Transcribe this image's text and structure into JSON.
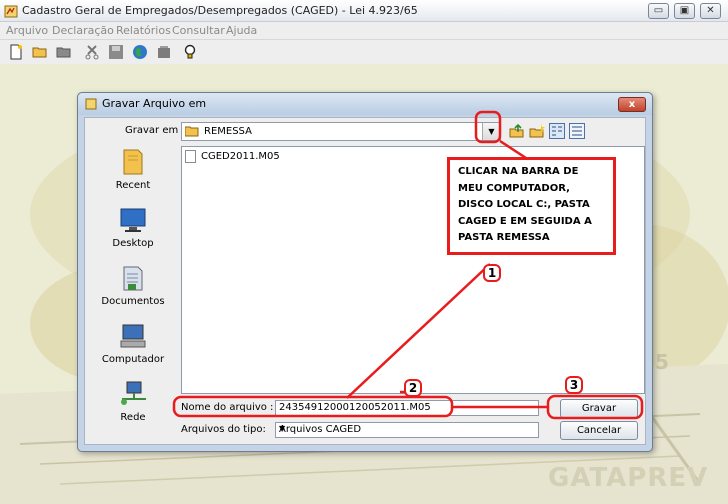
{
  "window": {
    "title": "Cadastro Geral de Empregados/Desempregados (CAGED) - Lei 4.923/65",
    "controls": {
      "minimize": "▭",
      "maximize": "▣",
      "close": "✕"
    }
  },
  "menu": [
    "Arquivo",
    "Declaração",
    "Relatórios",
    "Consultar",
    "Ajuda"
  ],
  "toolbar_icons": [
    "new-file-icon",
    "open-folder-icon",
    "folder-icon",
    "scissors-icon",
    "save-icon",
    "globe-icon",
    "disk-icon",
    "lightbulb-icon"
  ],
  "dialog": {
    "title": "Gravar Arquivo em",
    "close_label": "x",
    "look_in_label": "Gravar em",
    "look_in_value": "REMESSA",
    "places": [
      {
        "label": "Recent",
        "icon": "recent-folder-icon"
      },
      {
        "label": "Desktop",
        "icon": "desktop-icon"
      },
      {
        "label": "Documentos",
        "icon": "documents-icon"
      },
      {
        "label": "Computador",
        "icon": "computer-icon"
      },
      {
        "label": "Rede",
        "icon": "network-icon"
      }
    ],
    "files": [
      "CGED2011.M05"
    ],
    "filename_label": "Nome do arquivo :",
    "filename_value": "24354912000120052011.M05",
    "filetype_label": "Arquivos do tipo:",
    "filetype_value": "Arquivos CAGED",
    "save_button": "Gravar",
    "cancel_button": "Cancelar"
  },
  "annotations": {
    "callout_lines": [
      "CLICAR NA BARRA DE",
      "MEU COMPUTADOR,",
      "DISCO  LOCAL C:, PASTA",
      "CAGED E EM SEGUIDA A",
      "PASTA REMESSA"
    ],
    "step_labels": [
      "1",
      "2",
      "3"
    ],
    "color": "#e81c1c"
  },
  "background": {
    "brand": "GATAPREV",
    "digit": "5"
  }
}
